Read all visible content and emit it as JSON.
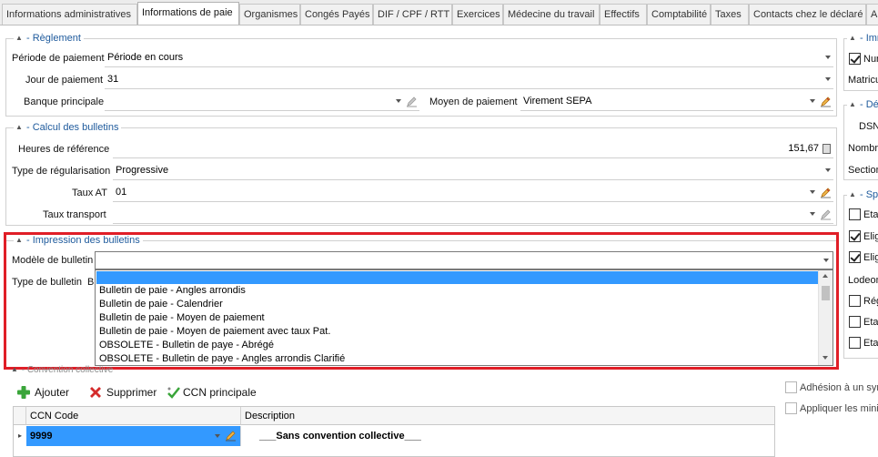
{
  "tabs": [
    {
      "label": "Informations administratives"
    },
    {
      "label": "Informations de paie"
    },
    {
      "label": "Organismes"
    },
    {
      "label": "Congés Payés"
    },
    {
      "label": "DIF / CPF / RTT"
    },
    {
      "label": "Exercices"
    },
    {
      "label": "Médecine du travail"
    },
    {
      "label": "Effectifs"
    },
    {
      "label": "Comptabilité"
    },
    {
      "label": "Taxes"
    },
    {
      "label": "Contacts chez le déclaré"
    },
    {
      "label": "A"
    }
  ],
  "reglement": {
    "title": "Règlement",
    "periode_label": "Période de paiement",
    "periode_value": "Période en cours",
    "jour_label": "Jour de paiement",
    "jour_value": "31",
    "banque_label": "Banque principale",
    "banque_value": "",
    "moyen_label": "Moyen de paiement",
    "moyen_value": "Virement SEPA"
  },
  "calcul": {
    "title": "Calcul des bulletins",
    "heures_label": "Heures de référence",
    "heures_value": "151,67",
    "regul_label": "Type de régularisation",
    "regul_value": "Progressive",
    "taux_at_label": "Taux AT",
    "taux_at_value": "01",
    "transport_label": "Taux transport",
    "transport_value": ""
  },
  "impression": {
    "title": "Impression des bulletins",
    "modele_label": "Modèle de bulletin",
    "modele_value": "",
    "type_label": "Type de bulletin",
    "type_value_fragment": "B",
    "options": [
      {
        "label": ""
      },
      {
        "label": "Bulletin de paie - Angles arrondis"
      },
      {
        "label": "Bulletin de paie - Calendrier"
      },
      {
        "label": "Bulletin de paie - Moyen de paiement"
      },
      {
        "label": "Bulletin de paie - Moyen de paiement avec taux Pat."
      },
      {
        "label": "OBSOLETE - Bulletin de paye - Abrégé"
      },
      {
        "label": "OBSOLETE - Bulletin de paye - Angles arrondis Clarifié"
      }
    ]
  },
  "convention": {
    "title": "Convention collective",
    "add_label": "Ajouter",
    "delete_label": "Supprimer",
    "ccn_label": "CCN principale",
    "columns": [
      "CCN Code",
      "Description"
    ],
    "rows": [
      {
        "code": "9999",
        "description": "___Sans convention collective___"
      }
    ]
  },
  "right_panel": {
    "group1_title": "Imm",
    "group1_chk_label": "Num",
    "group1_label": "Matricu",
    "group2_title": "Déc",
    "dsn_label": "DSN",
    "nombre_label": "Nombre",
    "section_label": "Section",
    "group3_title": "Spé",
    "items": [
      {
        "label": "Eta",
        "checked": false
      },
      {
        "label": "Elig",
        "checked": true
      },
      {
        "label": "Elig",
        "checked": true
      }
    ],
    "lodeom_label": "Lodeom",
    "items2": [
      {
        "label": "Rég",
        "checked": false
      },
      {
        "label": "Eta",
        "checked": false
      },
      {
        "label": "Eta",
        "checked": false
      }
    ],
    "adhesion_label": "Adhésion à un syn",
    "appliquer_label": "Appliquer les mini"
  },
  "colors": {
    "accent": "#1e5a9c",
    "highlight": "#e01e27",
    "selection": "#3399ff"
  }
}
